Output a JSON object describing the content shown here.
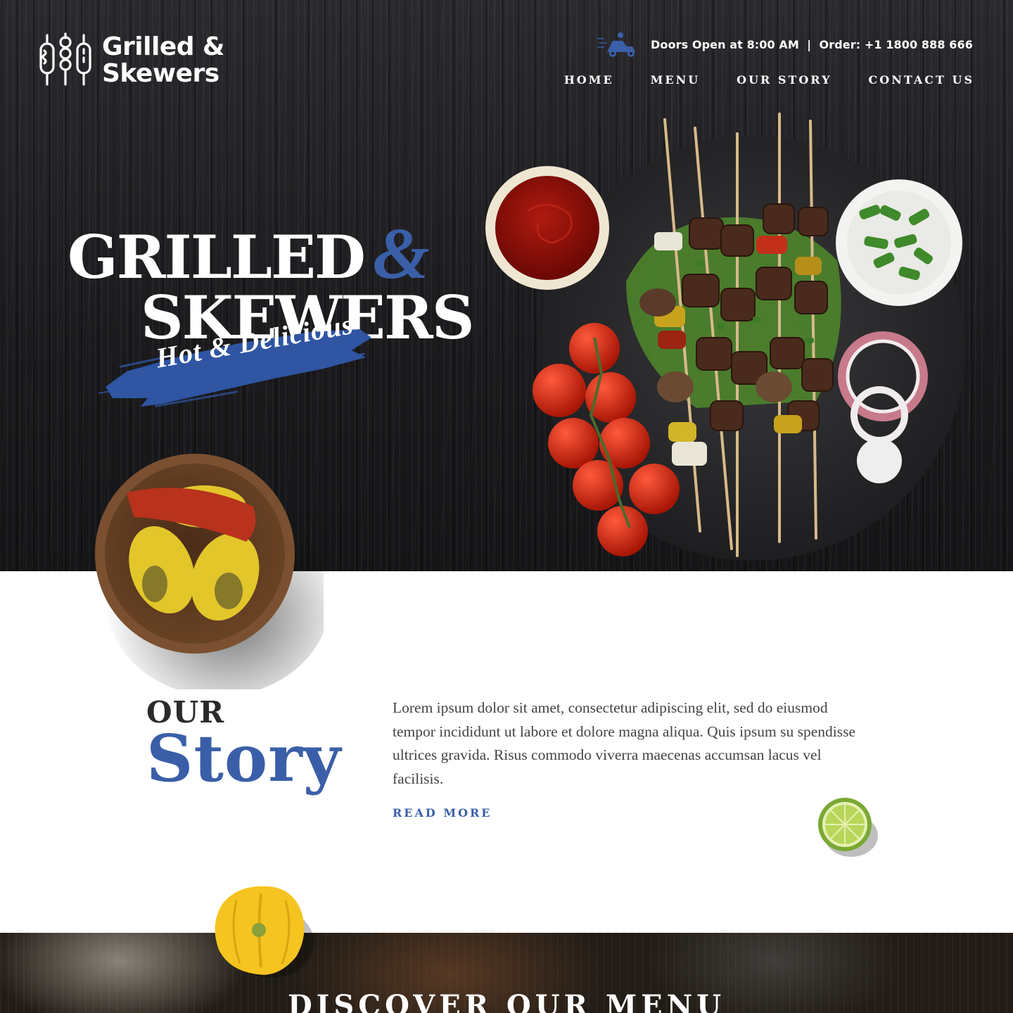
{
  "brand": {
    "name_line1": "Grilled &",
    "name_line2": "Skewers",
    "icon": "skewers-logo-icon"
  },
  "topbar": {
    "delivery_icon": "delivery-scooter-icon",
    "info": "Doors Open at 8:00 AM  |  Order: +1 1800 888 666"
  },
  "nav": {
    "items": [
      {
        "label": "HOME"
      },
      {
        "label": "MENU"
      },
      {
        "label": "OUR STORY"
      },
      {
        "label": "CONTACT US"
      }
    ]
  },
  "hero": {
    "title_line1": "GRILLED",
    "title_amp": "&",
    "title_line2": "SKEWERS",
    "tagline": "Hot & Delicious"
  },
  "story": {
    "heading_small": "OUR",
    "heading_large": "Story",
    "body": "Lorem ipsum dolor sit amet, consectetur adipiscing elit, sed do eiusmod tempor incididunt ut labore et dolore magna aliqua. Quis ipsum su spendisse ultrices gravida. Risus commodo viverra maecenas accumsan lacus vel facilisis.",
    "read_more": "READ MORE"
  },
  "menu_section": {
    "title": "DISCOVER OUR MENU"
  },
  "colors": {
    "accent": "#3a5fa8",
    "hero_bg": "#1f1f22",
    "text_dark": "#2b2b2b",
    "text_body": "#444444"
  }
}
